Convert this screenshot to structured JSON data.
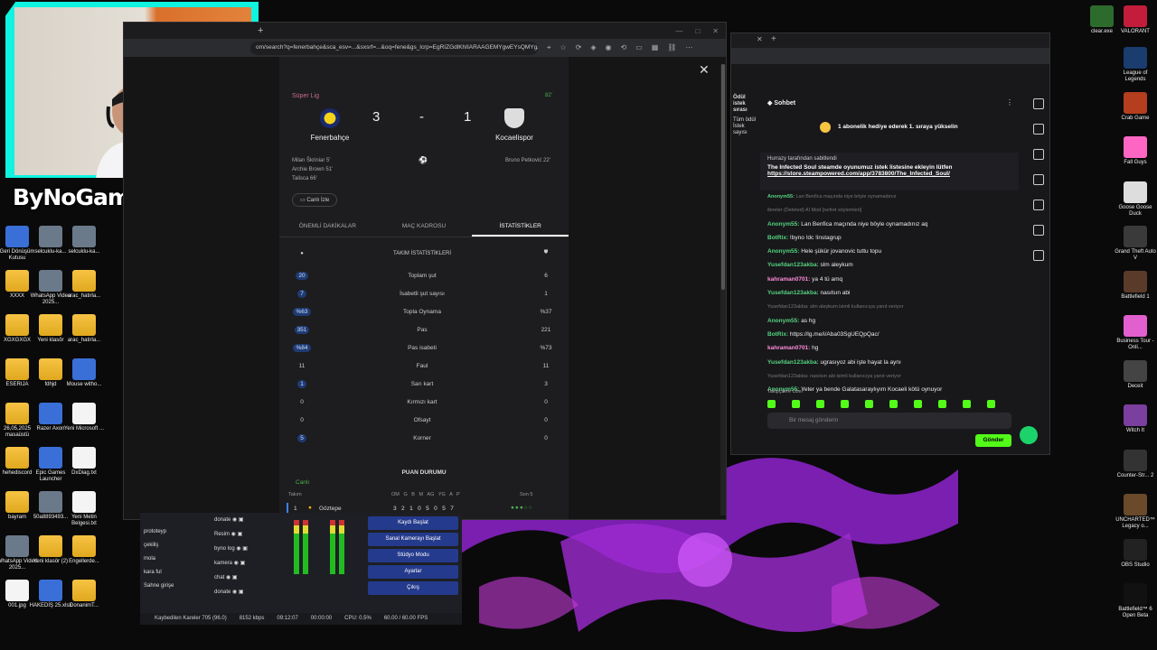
{
  "webcam": {
    "brand": "ByNoGame",
    "kick_count": "25"
  },
  "desktop_left": [
    {
      "label": "Geri Dönüşüm Kutusu",
      "kind": "app"
    },
    {
      "label": "selcuklu-ka...",
      "kind": "img"
    },
    {
      "label": "selcuklu-ka...",
      "kind": "img"
    },
    {
      "label": "XXXX",
      "kind": "folder"
    },
    {
      "label": "WhatsApp Video 2025...",
      "kind": "img"
    },
    {
      "label": "arac_hatirla...",
      "kind": "folder"
    },
    {
      "label": "XGXGXGX",
      "kind": "folder"
    },
    {
      "label": "Yeni klasör",
      "kind": "folder"
    },
    {
      "label": "arac_hatirla...",
      "kind": "folder"
    },
    {
      "label": "ESERIJA",
      "kind": "folder"
    },
    {
      "label": "fdhjd",
      "kind": "folder"
    },
    {
      "label": "Mouse witho...",
      "kind": "app"
    },
    {
      "label": "26,05,2025 masaüstü",
      "kind": "folder"
    },
    {
      "label": "Razer Axon",
      "kind": "app"
    },
    {
      "label": "Yeni Microsoft ...",
      "kind": "doc"
    },
    {
      "label": "hehediscord",
      "kind": "folder"
    },
    {
      "label": "Epic Games Launcher",
      "kind": "app"
    },
    {
      "label": "DxDiag.txt",
      "kind": "doc"
    },
    {
      "label": "bayram",
      "kind": "folder"
    },
    {
      "label": "50a8893493...",
      "kind": "img"
    },
    {
      "label": "Yeni Metin Belgesi.txt",
      "kind": "doc"
    },
    {
      "label": "WhatsApp Video 2025...",
      "kind": "img"
    },
    {
      "label": "Yeni klasör (2)",
      "kind": "folder"
    },
    {
      "label": "Engellerde...",
      "kind": "folder"
    },
    {
      "label": "001.jpg",
      "kind": "doc"
    },
    {
      "label": "HAKEDİŞ 25.xlsx",
      "kind": "app"
    },
    {
      "label": "DonanimT...",
      "kind": "folder"
    }
  ],
  "desktop_right": [
    {
      "label": "clear.exe",
      "kind": "app"
    },
    {
      "label": "VALORANT",
      "kind": "app"
    },
    {
      "label": "League of Legends",
      "kind": "app"
    },
    {
      "label": "Crab Game",
      "kind": "app"
    },
    {
      "label": "Fall Guys",
      "kind": "app"
    },
    {
      "label": "Goose Goose Duck",
      "kind": "app"
    },
    {
      "label": "Grand Theft Auto V",
      "kind": "app"
    },
    {
      "label": "Battlefield 1",
      "kind": "app"
    },
    {
      "label": "Business Tour - Onli...",
      "kind": "app"
    },
    {
      "label": "Deceit",
      "kind": "app"
    },
    {
      "label": "Witch It",
      "kind": "app"
    },
    {
      "label": "Counter-Str... 2",
      "kind": "app"
    },
    {
      "label": "UNCHARTED™ Legacy o...",
      "kind": "app"
    },
    {
      "label": "OBS Studio",
      "kind": "app"
    },
    {
      "label": "Battlefield™ 6 Open Beta",
      "kind": "app"
    }
  ],
  "browser": {
    "url": "om/search?q=fenerbahçe&sca_esv=...&sxsrf=...&oq=fene&gs_lcrp=EgRIZGdlKhIIARAAGEMYgwEYsQMYgAQY...",
    "league": "Süper Lig",
    "status": "82'",
    "home": "Fenerbahçe",
    "away": "Kocaelispor",
    "home_score": "3",
    "away_score": "1",
    "dash": "-",
    "scorers_home": [
      "Milan Škriniar 5'",
      "Archie Brown 51'",
      "Talisca 66'"
    ],
    "scorers_away": [
      "Bruno Petković 22'"
    ],
    "live_btn": "Canlı İzle",
    "tabs": [
      "ÖNEMLİ DAKİKALAR",
      "MAÇ KADROSU",
      "İSTATİSTİKLER"
    ],
    "stats_title": "TAKIM İSTATİSTİKLERİ",
    "stats": [
      {
        "l": "20",
        "m": "Toplam şut",
        "r": "6",
        "hl": true
      },
      {
        "l": "7",
        "m": "İsabetli şut sayısı",
        "r": "1",
        "hl": true
      },
      {
        "l": "%63",
        "m": "Topla Oynama",
        "r": "%37",
        "hl": true
      },
      {
        "l": "351",
        "m": "Pas",
        "r": "221",
        "hl": true
      },
      {
        "l": "%84",
        "m": "Pas isabeti",
        "r": "%73",
        "hl": true
      },
      {
        "l": "11",
        "m": "Faul",
        "r": "11",
        "hl": false
      },
      {
        "l": "1",
        "m": "Sarı kart",
        "r": "3",
        "hl": true
      },
      {
        "l": "0",
        "m": "Kırmızı kart",
        "r": "0",
        "hl": false
      },
      {
        "l": "0",
        "m": "Ofsayt",
        "r": "0",
        "hl": false
      },
      {
        "l": "5",
        "m": "Korner",
        "r": "0",
        "hl": true
      }
    ],
    "standings_title": "PUAN DURUMU",
    "standings_live": "Canlı",
    "standings_header": {
      "team": "Takım",
      "cols": "OM   G   B   M   AG   YG   A   P",
      "last5": "Son 5"
    },
    "standings_row": {
      "pos": "1",
      "team": "Göztepe",
      "vals": "3   2   1   0   5   0   5   7"
    }
  },
  "chat": {
    "side_label": "Ödül istek sırası",
    "side_sub": "Tüm ödül",
    "side_sub2": "İstek sayısı",
    "title": "Sohbet",
    "goal": "1 abonelik hediye ederek 1. sıraya yükselin",
    "pinned_by": "Hurrazy tarafından sabitlendi",
    "pinned_text": "The Infected Soul steamde oyunumuz istek listesine ekleyin lütfen",
    "pinned_link": "https://store.steampowered.com/app/3783800/The_Infected_Soul/",
    "messages": [
      {
        "u": "Anonym55:",
        "t": "Lan Benfica maçında niye böyle oynamadınız",
        "c": "g",
        "dim": true
      },
      {
        "u": "",
        "t": "ibneler (Deleted)  AI Mod  [nefret söylemleri]",
        "c": "g",
        "dim": true
      },
      {
        "u": "Anonym55:",
        "t": "Lan Benfica maçında niye böyle oynamadınız aq",
        "c": "g",
        "dim": false
      },
      {
        "u": "BotRix:",
        "t": "!byno !dc !instagrup",
        "c": "g",
        "dim": false
      },
      {
        "u": "Anonym55:",
        "t": "Hele şükür jovanovic tuttu topu",
        "c": "g",
        "dim": false
      },
      {
        "u": "Yusefdan123akba:",
        "t": "slm aleykum",
        "c": "g",
        "dim": false
      },
      {
        "u": "kahraman0701:",
        "t": "ya 4 tü amq",
        "c": "p",
        "dim": false
      },
      {
        "u": "Yusefdan123akba:",
        "t": "nasılsın abi",
        "c": "g",
        "dim": false
      },
      {
        "u": "",
        "t": "Yusefdan123akba: slm aleykum isimli kullanıcıya yanıt veriyor",
        "c": "g",
        "dim": true
      },
      {
        "u": "Anonym55:",
        "t": "as hg",
        "c": "g",
        "dim": false
      },
      {
        "u": "BotRix:",
        "t": "https://lg.me/i/Aba03SgUEQpQac/",
        "c": "g",
        "dim": false
      },
      {
        "u": "kahraman0701:",
        "t": "hg",
        "c": "p",
        "dim": false
      },
      {
        "u": "Yusefdan123akba:",
        "t": "ugrasıyoz abi işte hayat la aynı",
        "c": "g",
        "dim": false
      },
      {
        "u": "",
        "t": "Yusefdan123akba: nasılsın abi isimli kullanıcıya yanıt veriyor",
        "c": "g",
        "dim": true
      },
      {
        "u": "Anonym55:",
        "t": "Yeter ya bende Galatasaraylıyım Kocaeli kötü oynuyor",
        "c": "g",
        "dim": false
      }
    ],
    "followers_label": "Takipçilere Özel",
    "input_placeholder": "Bir mesaj gönderin",
    "send": "Gönder"
  },
  "obs": {
    "scenes": [
      "prototeyp",
      "çekiliş",
      "mola",
      "kara ful",
      "Sahne girişe"
    ],
    "sources": [
      "donate",
      "Resim",
      "byno log",
      "kamera",
      "chat",
      "donate"
    ],
    "buttons": [
      "Kaydı Başlat",
      "Sanal Kamerayı Başlat",
      "Stüdyo Modu",
      "Ayarlar",
      "Çıkış"
    ],
    "status": {
      "dropped": "Kaybedilen Kareler 705 (96.0)",
      "bitrate": "8152 kbps",
      "live": "09:12:07",
      "rec": "00:00:00",
      "cpu": "CPU: 0.5%",
      "fps": "60.00 / 60.00 FPS"
    }
  }
}
